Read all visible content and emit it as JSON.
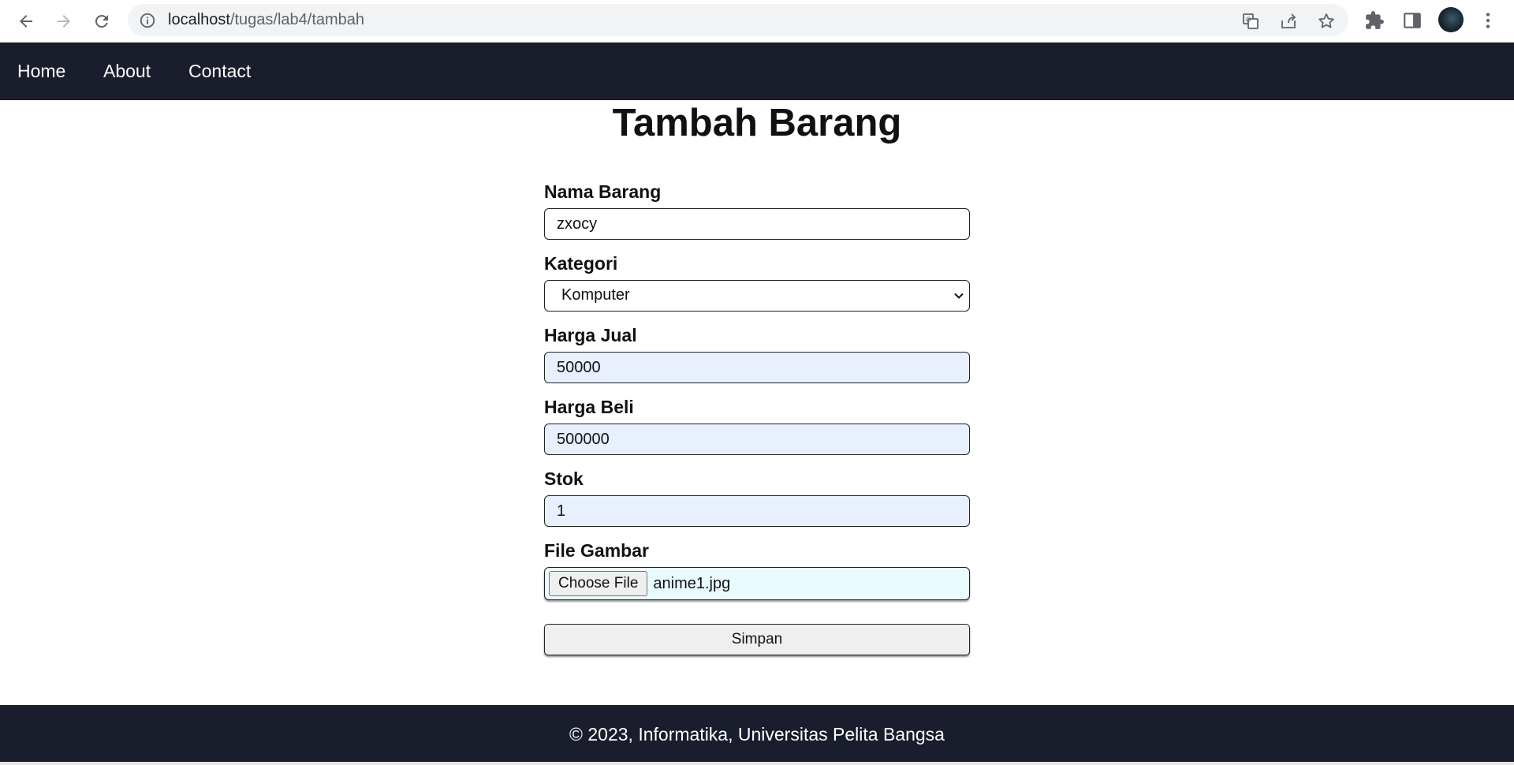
{
  "browser": {
    "url_host": "localhost",
    "url_path": "/tugas/lab4/tambah"
  },
  "nav": {
    "items": [
      {
        "label": "Home"
      },
      {
        "label": "About"
      },
      {
        "label": "Contact"
      }
    ]
  },
  "main": {
    "title": "Tambah Barang",
    "fields": {
      "nama": {
        "label": "Nama Barang",
        "value": "zxocy"
      },
      "kategori": {
        "label": "Kategori",
        "value": "Komputer"
      },
      "harga_jual": {
        "label": "Harga Jual",
        "value": "50000"
      },
      "harga_beli": {
        "label": "Harga Beli",
        "value": "500000"
      },
      "stok": {
        "label": "Stok",
        "value": "1"
      },
      "gambar": {
        "label": "File Gambar",
        "button": "Choose File",
        "filename": "anime1.jpg"
      }
    },
    "submit_label": "Simpan"
  },
  "footer": {
    "text": "© 2023, Informatika, Universitas Pelita Bangsa"
  },
  "colors": {
    "nav_bg": "#1a1d2b",
    "autofill_bg": "#e8f0fe"
  }
}
